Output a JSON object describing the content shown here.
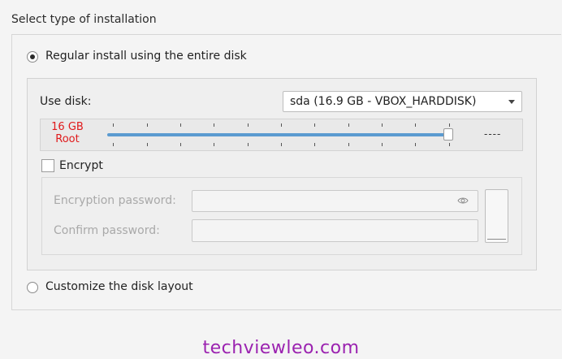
{
  "installation": {
    "section_title": "Select type of installation",
    "option_regular_label": "Regular install using the entire disk",
    "option_custom_label": "Customize the disk layout",
    "selected_option": "regular"
  },
  "disk": {
    "use_disk_label": "Use disk:",
    "selected_disk": "sda (16.9 GB - VBOX_HARDDISK)",
    "size_label_line1": "16 GB",
    "size_label_line2": "Root",
    "slider_value_fraction": 1.0,
    "remaining_label": "----"
  },
  "encryption": {
    "checkbox_label": "Encrypt",
    "checked": false,
    "password_label": "Encryption password:",
    "confirm_label": "Confirm password:"
  },
  "watermark": "techviewleo.com",
  "colors": {
    "slider_track": "#5b9bd0",
    "size_label": "#e0191b",
    "watermark": "#9b22b0"
  }
}
